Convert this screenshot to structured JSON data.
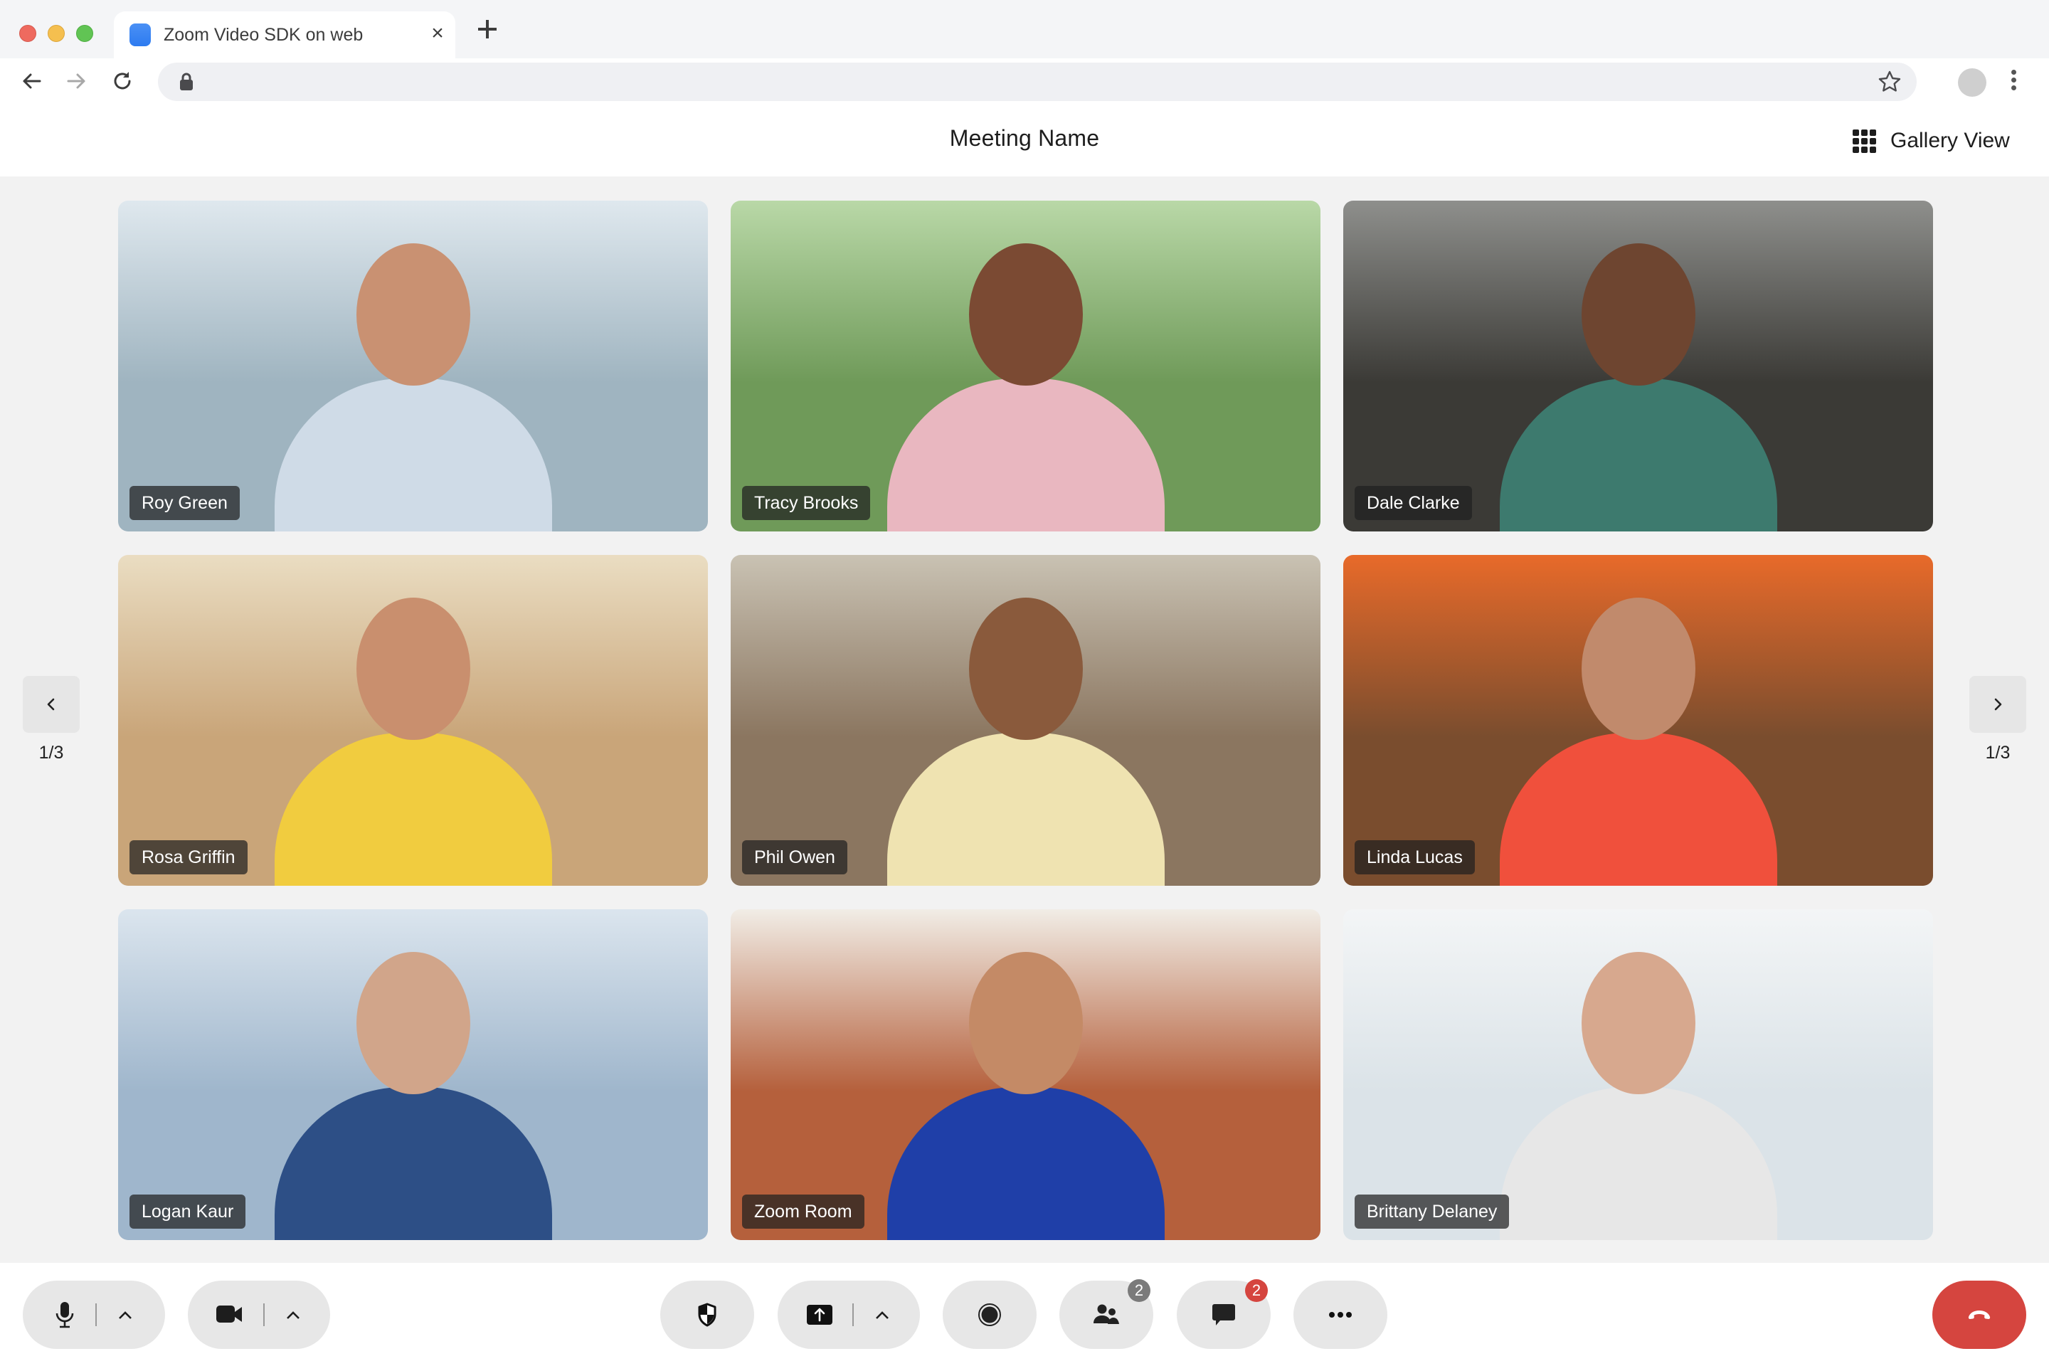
{
  "browser": {
    "tab_title": "Zoom Video SDK on web",
    "tab_close_icon": "close-icon",
    "new_tab_icon": "plus-icon",
    "url": "",
    "nav_icons": [
      "back-arrow-icon",
      "forward-arrow-icon",
      "reload-icon"
    ],
    "url_icons": [
      "lock-icon",
      "star-icon"
    ],
    "menu_icon": "kebab-menu-icon"
  },
  "header": {
    "meeting_name": "Meeting Name",
    "view_label": "Gallery View",
    "view_icon": "grid-icon"
  },
  "gallery": {
    "page_indicator_left": "1/3",
    "page_indicator_right": "1/3",
    "prev_icon": "chevron-left-icon",
    "next_icon": "chevron-right-icon",
    "participants": [
      {
        "name": "Roy Green",
        "bg": "#9fb4c0",
        "accent": "#dfe8ee",
        "skin": "#c99172",
        "shirt": "#cfdbe7"
      },
      {
        "name": "Tracy Brooks",
        "bg": "#6f9a59",
        "accent": "#b9d8a7",
        "skin": "#7b4a33",
        "shirt": "#e9b7c0"
      },
      {
        "name": "Dale Clarke",
        "bg": "#3b3a36",
        "accent": "#8e8f8c",
        "skin": "#6e4530",
        "shirt": "#3d7a6e"
      },
      {
        "name": "Rosa Griffin",
        "bg": "#c9a579",
        "accent": "#eaddc2",
        "skin": "#c98f6e",
        "shirt": "#f1cc3f"
      },
      {
        "name": "Phil Owen",
        "bg": "#8b7660",
        "accent": "#c9c2b3",
        "skin": "#8a5a3c",
        "shirt": "#efe3b1"
      },
      {
        "name": "Linda Lucas",
        "bg": "#7a4d2e",
        "accent": "#e86a2a",
        "skin": "#c18a6c",
        "shirt": "#f0503c"
      },
      {
        "name": "Logan Kaur",
        "bg": "#9fb6cc",
        "accent": "#dbe5ee",
        "skin": "#d1a58a",
        "shirt": "#2d4f86"
      },
      {
        "name": "Zoom Room",
        "bg": "#b5603c",
        "accent": "#f1ede6",
        "skin": "#c48a66",
        "shirt": "#1f3fa8"
      },
      {
        "name": "Brittany Delaney",
        "bg": "#dbe3e8",
        "accent": "#f3f5f6",
        "skin": "#d7a88e",
        "shirt": "#e7e7e7"
      }
    ]
  },
  "footer": {
    "mic_icon": "microphone-icon",
    "video_icon": "video-camera-icon",
    "security_icon": "shield-icon",
    "share_icon": "share-screen-icon",
    "record_icon": "record-icon",
    "participants_icon": "participants-icon",
    "participants_count": "2",
    "chat_icon": "chat-icon",
    "chat_unread": "2",
    "more_icon": "more-icon",
    "leave_icon": "hang-up-icon",
    "colors": {
      "participants_badge": "#7a7a7a",
      "chat_badge": "#d5453f",
      "end_call": "#d5453f"
    }
  }
}
